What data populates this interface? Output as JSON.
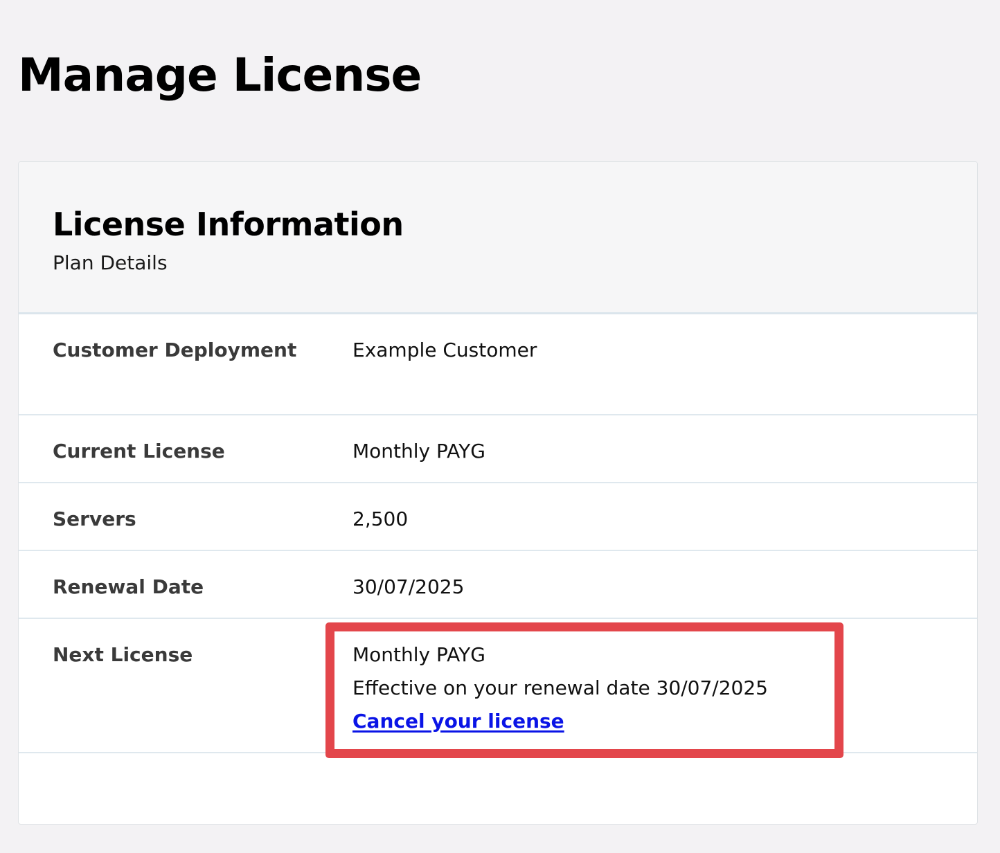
{
  "page": {
    "title": "Manage License"
  },
  "card": {
    "title": "License Information",
    "subtitle": "Plan Details"
  },
  "rows": [
    {
      "label": "Customer Deployment",
      "value": "Example Customer"
    },
    {
      "label": "Current License",
      "value": "Monthly PAYG"
    },
    {
      "label": "Servers",
      "value": "2,500"
    },
    {
      "label": "Renewal Date",
      "value": "30/07/2025"
    },
    {
      "label": "Next License",
      "value": "Monthly PAYG",
      "note": "Effective on your renewal date 30/07/2025",
      "link": "Cancel your license"
    }
  ],
  "colors": {
    "highlight": "#e3464b",
    "link": "#0a14e6",
    "background": "#f3f2f4"
  }
}
